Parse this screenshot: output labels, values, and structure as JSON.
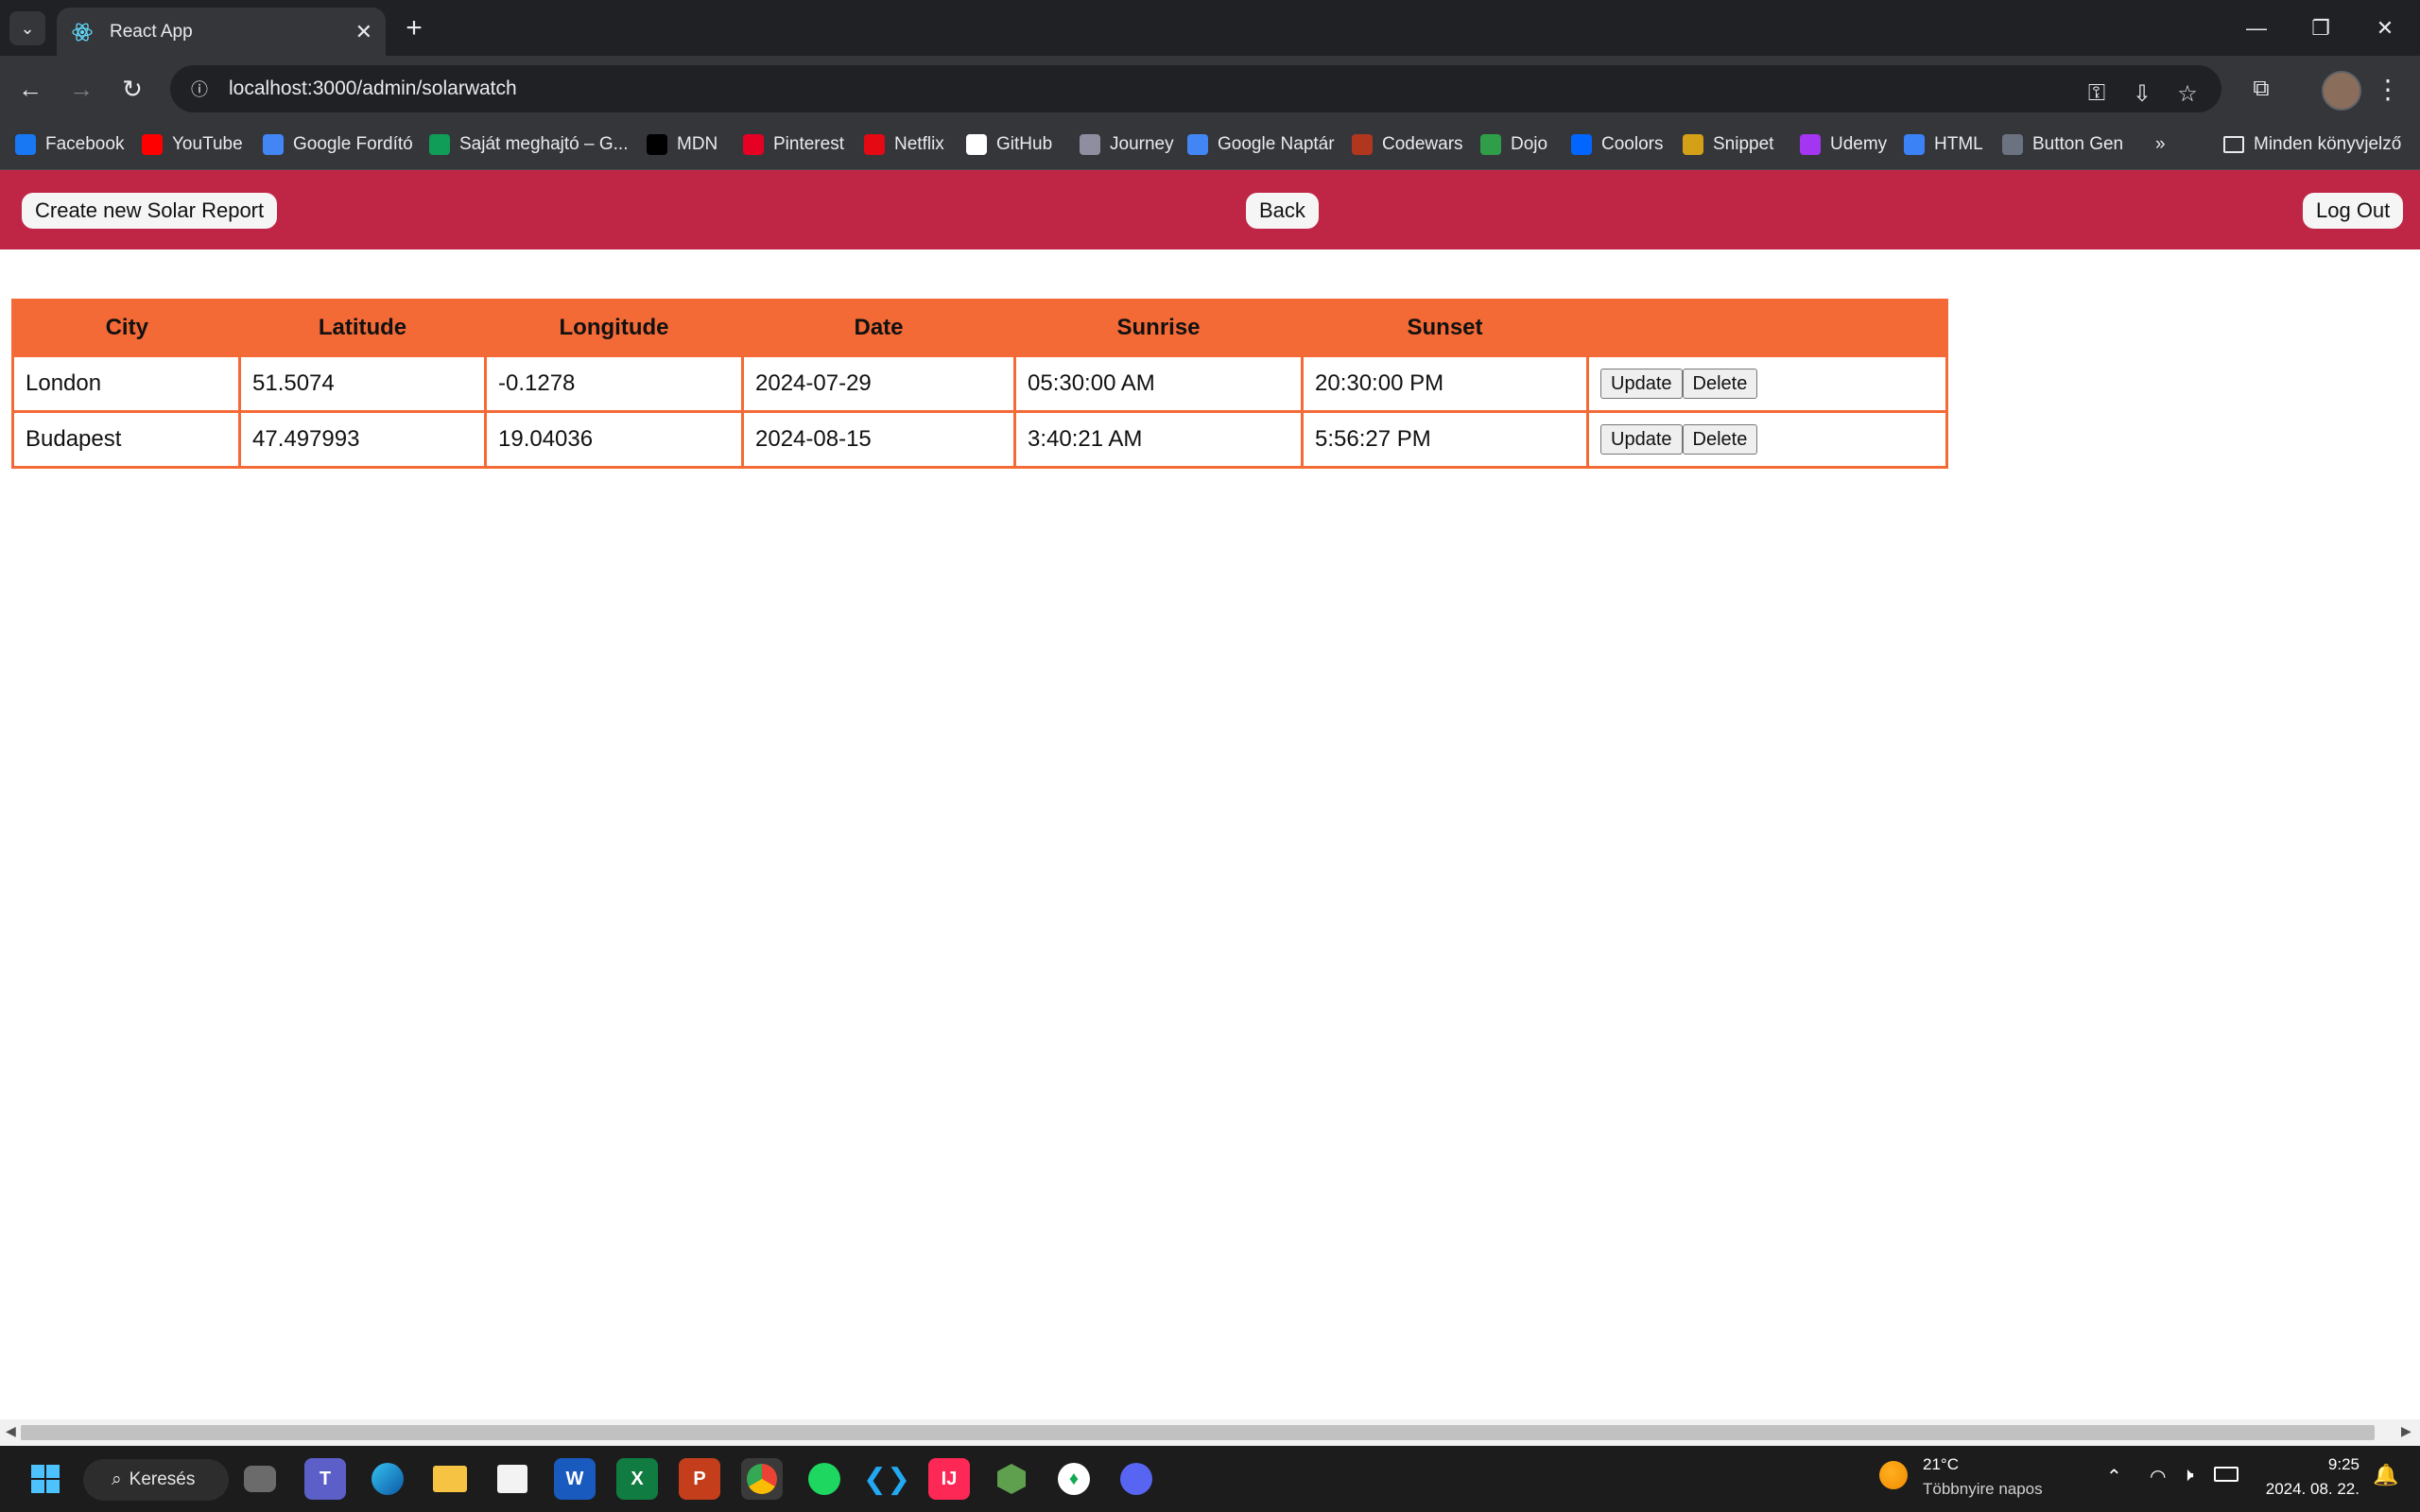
{
  "browser": {
    "tab_title": "React App",
    "url": "localhost:3000/admin/solarwatch",
    "bookmarks": [
      {
        "label": "Facebook",
        "icon": "facebook-icon",
        "color": "#1877f2"
      },
      {
        "label": "YouTube",
        "icon": "youtube-icon",
        "color": "#ff0000"
      },
      {
        "label": "Google Fordító",
        "icon": "google-translate-icon",
        "color": "#4285f4"
      },
      {
        "label": "Saját meghajtó – G...",
        "icon": "google-drive-icon",
        "color": "#0f9d58"
      },
      {
        "label": "MDN",
        "icon": "mdn-icon",
        "color": "#000000"
      },
      {
        "label": "Pinterest",
        "icon": "pinterest-icon",
        "color": "#e60023"
      },
      {
        "label": "Netflix",
        "icon": "netflix-icon",
        "color": "#e50914"
      },
      {
        "label": "GitHub",
        "icon": "github-icon",
        "color": "#ffffff"
      },
      {
        "label": "Journey",
        "icon": "journey-icon",
        "color": "#8e8ea0"
      },
      {
        "label": "Google Naptár",
        "icon": "google-calendar-icon",
        "color": "#4285f4"
      },
      {
        "label": "Codewars",
        "icon": "codewars-icon",
        "color": "#b1361e"
      },
      {
        "label": "Dojo",
        "icon": "dojo-icon",
        "color": "#2e9e48"
      },
      {
        "label": "Coolors",
        "icon": "coolors-icon",
        "color": "#0066ff"
      },
      {
        "label": "Snippet",
        "icon": "snippet-icon",
        "color": "#d4a017"
      },
      {
        "label": "Udemy",
        "icon": "udemy-icon",
        "color": "#a435f0"
      },
      {
        "label": "HTML",
        "icon": "html-icon",
        "color": "#3b82f6"
      },
      {
        "label": "Button Gen",
        "icon": "button-gen-icon",
        "color": "#6b7280"
      }
    ],
    "bookmarks_overflow": "»",
    "all_bookmarks_label": "Minden könyvjelző"
  },
  "app": {
    "create_label": "Create new Solar Report",
    "back_label": "Back",
    "logout_label": "Log Out",
    "header_color": "#bf2645",
    "table_accent": "#f46a36"
  },
  "table": {
    "headers": [
      "City",
      "Latitude",
      "Longitude",
      "Date",
      "Sunrise",
      "Sunset",
      ""
    ],
    "rows": [
      {
        "city": "London",
        "latitude": "51.5074",
        "longitude": "-0.1278",
        "date": "2024-07-29",
        "sunrise": "05:30:00 AM",
        "sunset": "20:30:00 PM"
      },
      {
        "city": "Budapest",
        "latitude": "47.497993",
        "longitude": "19.04036",
        "date": "2024-08-15",
        "sunrise": "3:40:21 AM",
        "sunset": "5:56:27 PM"
      }
    ],
    "update_label": "Update",
    "delete_label": "Delete"
  },
  "taskbar": {
    "search_label": "Keresés",
    "weather_temp": "21°C",
    "weather_desc": "Többnyire napos",
    "time": "9:25",
    "date": "2024. 08. 22."
  }
}
